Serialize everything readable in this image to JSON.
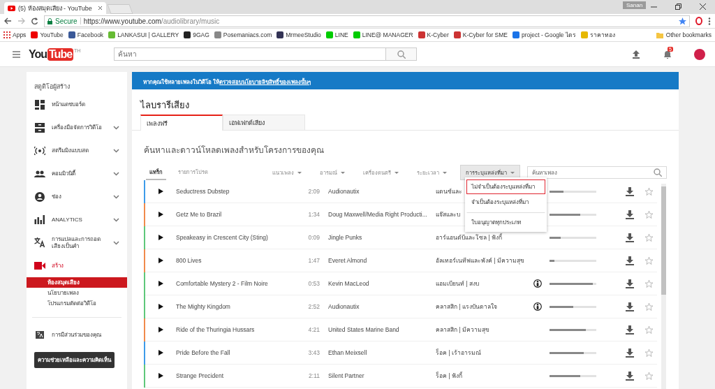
{
  "browser": {
    "tab_title": "(5) ห้องสมุดเสียง - YouTube",
    "profile": "Sanan",
    "secure_label": "Secure",
    "url_host": "https://www.youtube.com",
    "url_path": "/audiolibrary/music",
    "bookmarks": [
      "Apps",
      "YouTube",
      "Facebook",
      "LANKASUI | GALLERY",
      "9GAG",
      "Posemaniacs.com",
      "MrmeeStudio",
      "LINE",
      "LINE@ MANAGER",
      "K-Cyber",
      "K-Cyber for SME",
      "project - Google ไดร",
      "ราคาทอง"
    ],
    "other_bookmarks": "Other bookmarks"
  },
  "header": {
    "logo_you": "You",
    "logo_tube": "Tube",
    "region": "TH",
    "search_placeholder": "ค้นหา",
    "notification_count": "5"
  },
  "sidebar": {
    "title": "สตูดิโอผู้สร้าง",
    "items": [
      {
        "label": "หน้าแดชบอร์ด",
        "expandable": false,
        "selected": false
      },
      {
        "label": "เครื่องมือจัดการวิดีโอ",
        "expandable": true,
        "selected": false
      },
      {
        "label": "สตรีมมิงแบบสด",
        "expandable": true,
        "selected": false
      },
      {
        "label": "คอมมิวนิตี้",
        "expandable": true,
        "selected": false
      },
      {
        "label": "ช่อง",
        "expandable": true,
        "selected": false
      },
      {
        "label": "ANALYTICS",
        "expandable": true,
        "selected": false
      },
      {
        "label": "การแปลและการถอดเสียงเป็นคำ",
        "expandable": true,
        "selected": false
      },
      {
        "label": "สร้าง",
        "expandable": false,
        "selected": true,
        "children": [
          {
            "label": "ห้องสมุดเสียง",
            "selected": true
          },
          {
            "label": "นโยบายเพลง",
            "selected": false
          },
          {
            "label": "โปรแกรมตัดต่อวิดีโอ",
            "selected": false
          }
        ]
      }
    ],
    "contribution": "การมีส่วนร่วมของคุณ",
    "help_button": "ความช่วยเหลือและความคิดเห็น"
  },
  "banner": {
    "text": "หากคุณใช้หลายเพลงในวิดีโอ ให้",
    "link": "ตรวจสอบนโยบายลิขสิทธิ์ของเพลงนั้นๆ"
  },
  "page_title": "ไลบรารีเสียง",
  "tabs": [
    {
      "label": "เพลงฟรี",
      "selected": true
    },
    {
      "label": "เอฟเฟกต์เสียง",
      "selected": false
    }
  ],
  "heading": "ค้นหาและดาวน์โหลดเพลงสำหรับโครงการของคุณ",
  "subtabs": [
    {
      "label": "แทร็ก",
      "selected": true
    },
    {
      "label": "รายการโปรด",
      "selected": false
    }
  ],
  "filters": [
    {
      "label": "แนวเพลง",
      "open": false
    },
    {
      "label": "อารมณ์",
      "open": false
    },
    {
      "label": "เครื่องดนตรี",
      "open": false
    },
    {
      "label": "ระยะเวลา",
      "open": false
    },
    {
      "label": "การระบุแหล่งที่มา",
      "open": true
    }
  ],
  "track_search_placeholder": "ค้นหาเพลง",
  "dropdown": [
    {
      "label": "ไม่จำเป็นต้องระบุแหล่งที่มา",
      "selected": true
    },
    {
      "label": "จำเป็นต้องระบุแหล่งที่มา",
      "selected": false
    },
    {
      "label": "ใบอนุญาตทุกประเภท",
      "selected": false
    }
  ],
  "rows": [
    {
      "title": "Seductress Dubstep",
      "duration": "2:09",
      "artist": "Audionautix",
      "genre": "แดนซ์และ",
      "color": "#3d9be9",
      "attribution_icon": false,
      "level": 0.3
    },
    {
      "title": "Getz Me to Brazil",
      "duration": "1:34",
      "artist": "Doug Maxwell/Media Right Producti...",
      "genre": "แจ๊สและบ",
      "color": "#f08a4b",
      "attribution_icon": false,
      "level": 0.65
    },
    {
      "title": "Speakeasy in Crescent City (Sting)",
      "duration": "0:09",
      "artist": "Jingle Punks",
      "genre": "อาร์แอนด์บีและโซล | ฟังกี้",
      "color": "#5ec77a",
      "attribution_icon": false,
      "level": 0.24
    },
    {
      "title": "800 Lives",
      "duration": "1:47",
      "artist": "Everet Almond",
      "genre": "อัลเทอร์เนทีฟและพังค์ | มีความสุข",
      "color": "#f08a4b",
      "attribution_icon": false,
      "level": 0.1
    },
    {
      "title": "Comfortable Mystery 2 - Film Noire",
      "duration": "0:53",
      "artist": "Kevin MacLeod",
      "genre": "แอมเบียนท์ | สงบ",
      "color": "#5ec77a",
      "attribution_icon": true,
      "level": 0.92
    },
    {
      "title": "The Mighty Kingdom",
      "duration": "2:52",
      "artist": "Audionautix",
      "genre": "คลาสสิก | แรงบันดาลใจ",
      "color": "#5ec77a",
      "attribution_icon": true,
      "level": 0.5
    },
    {
      "title": "Ride of the Thuringia Hussars",
      "duration": "4:21",
      "artist": "United States Marine Band",
      "genre": "คลาสสิก | มีความสุข",
      "color": "#f08a4b",
      "attribution_icon": false,
      "level": 0.77
    },
    {
      "title": "Pride Before the Fall",
      "duration": "3:43",
      "artist": "Ethan Meixsell",
      "genre": "ร็อค | เร้าอารมณ์",
      "color": "#3d9be9",
      "attribution_icon": false,
      "level": 0.73
    },
    {
      "title": "Strange Precident",
      "duration": "2:11",
      "artist": "Silent Partner",
      "genre": "ร็อค | ฟังกี้",
      "color": "#5ec77a",
      "attribution_icon": false,
      "level": 0.66
    }
  ]
}
